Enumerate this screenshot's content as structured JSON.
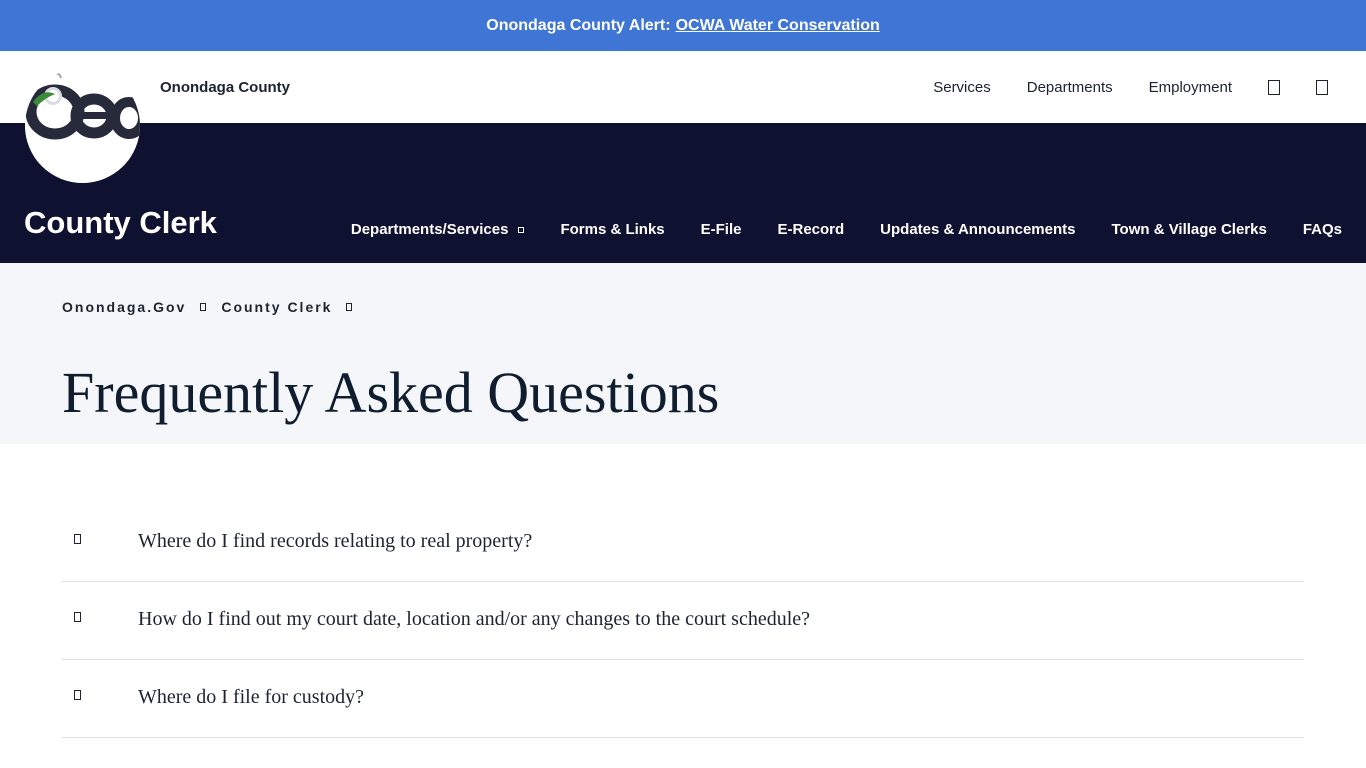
{
  "alert": {
    "prefix": "Onondaga County Alert:",
    "link_text": "OCWA Water Conservation"
  },
  "header": {
    "county_name": "Onondaga County",
    "links": [
      {
        "label": "Services"
      },
      {
        "label": "Departments"
      },
      {
        "label": "Employment"
      }
    ],
    "icons": [
      "search-icon",
      "menu-icon"
    ]
  },
  "department": {
    "title": "County Clerk",
    "nav": [
      {
        "label": "Departments/Services",
        "has_dropdown": true
      },
      {
        "label": "Forms & Links"
      },
      {
        "label": "E-File"
      },
      {
        "label": "E-Record"
      },
      {
        "label": "Updates & Announcements"
      },
      {
        "label": "Town & Village Clerks"
      },
      {
        "label": "FAQs"
      }
    ]
  },
  "breadcrumb": [
    {
      "label": "Onondaga.Gov"
    },
    {
      "label": "County Clerk"
    }
  ],
  "page": {
    "title": "Frequently Asked Questions"
  },
  "faq": [
    {
      "question": "Where do I find records relating to real property?"
    },
    {
      "question": "How do I find out my court date, location and/or any changes to the court schedule?"
    },
    {
      "question": "Where do I file for custody?"
    }
  ],
  "colors": {
    "alert_bg": "#3f75d4",
    "nav_bg": "#0f1130",
    "hero_bg": "#f4f6fa",
    "text": "#1d2330"
  }
}
